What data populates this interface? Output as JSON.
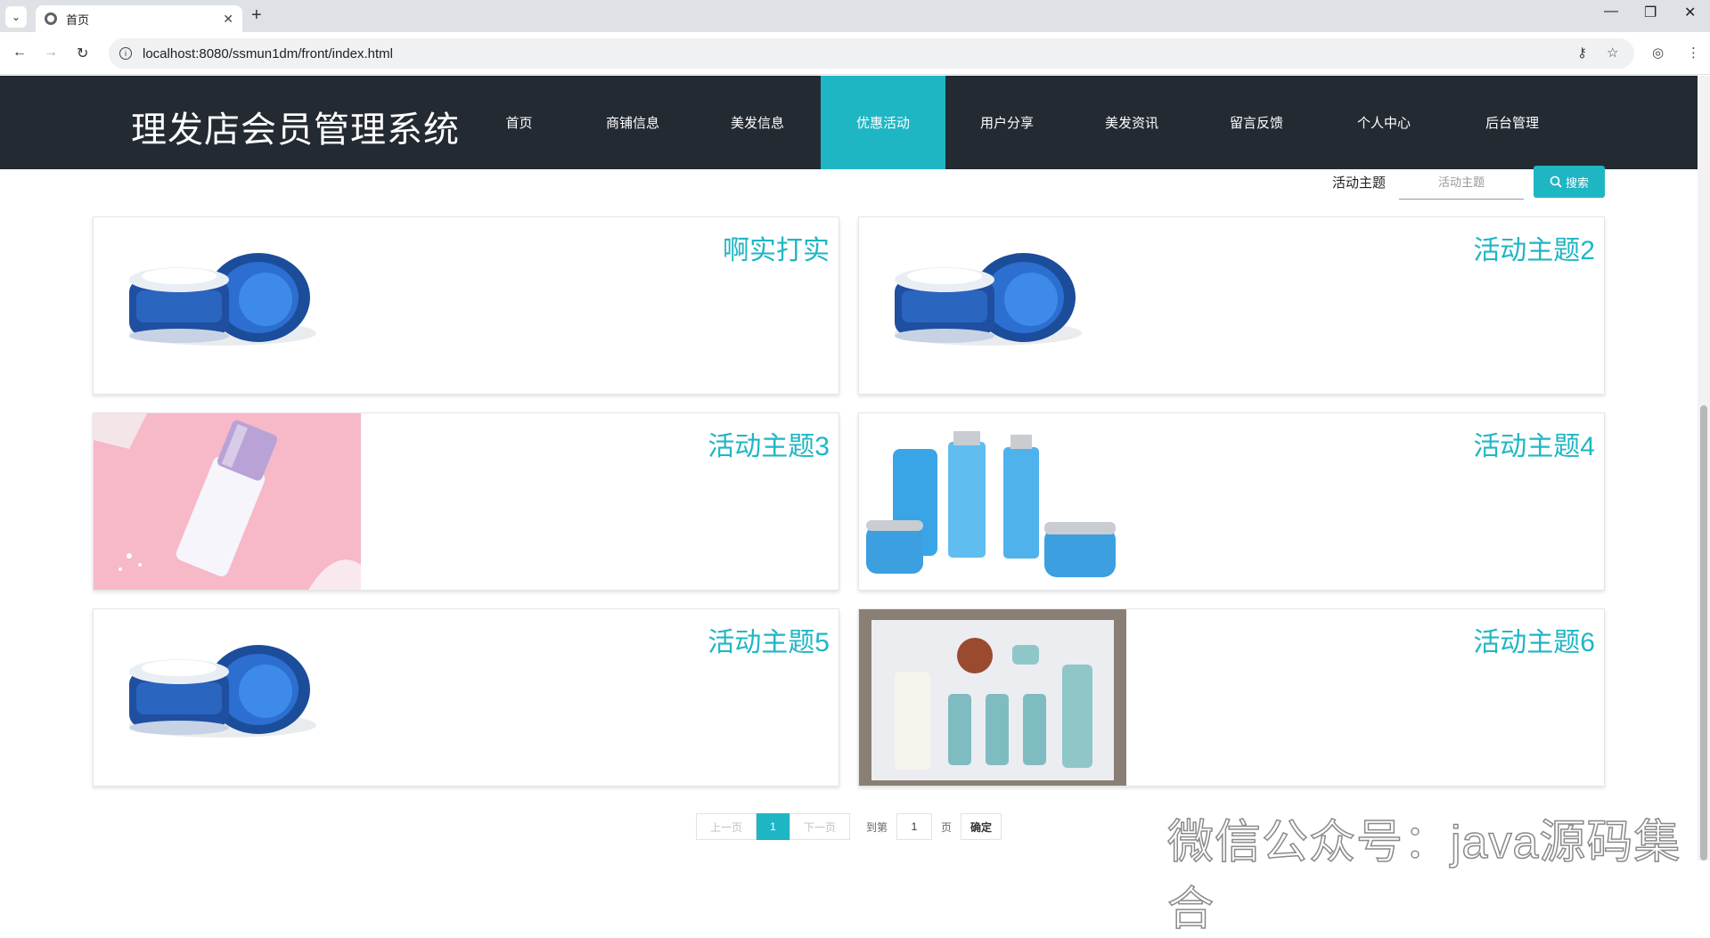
{
  "browser": {
    "tab_title": "首页",
    "url": "localhost:8080/ssmun1dm/front/index.html"
  },
  "site": {
    "title": "理发店会员管理系统",
    "nav": [
      "首页",
      "商铺信息",
      "美发信息",
      "优惠活动",
      "用户分享",
      "美发资讯",
      "留言反馈",
      "个人中心",
      "后台管理"
    ],
    "active_nav": "优惠活动"
  },
  "search": {
    "label": "活动主题",
    "placeholder": "活动主题",
    "button_label": "搜索"
  },
  "cards": [
    {
      "title": "啊实打实",
      "image": "blue-cream-jar"
    },
    {
      "title": "活动主题2",
      "image": "blue-cream-jar"
    },
    {
      "title": "活动主题3",
      "image": "pink-lotion-bottle"
    },
    {
      "title": "活动主题4",
      "image": "blue-skincare-set"
    },
    {
      "title": "活动主题5",
      "image": "blue-cream-jar"
    },
    {
      "title": "活动主题6",
      "image": "boxed-skincare-set"
    }
  ],
  "pagination": {
    "prev_label": "上一页",
    "current_page": "1",
    "next_label": "下一页",
    "goto_label": "到第",
    "goto_value": "1",
    "page_unit": "页",
    "confirm_label": "确定"
  },
  "watermark": "微信公众号：java源码集合",
  "colors": {
    "accent": "#1fb6c4",
    "header_bg": "#242a32"
  }
}
